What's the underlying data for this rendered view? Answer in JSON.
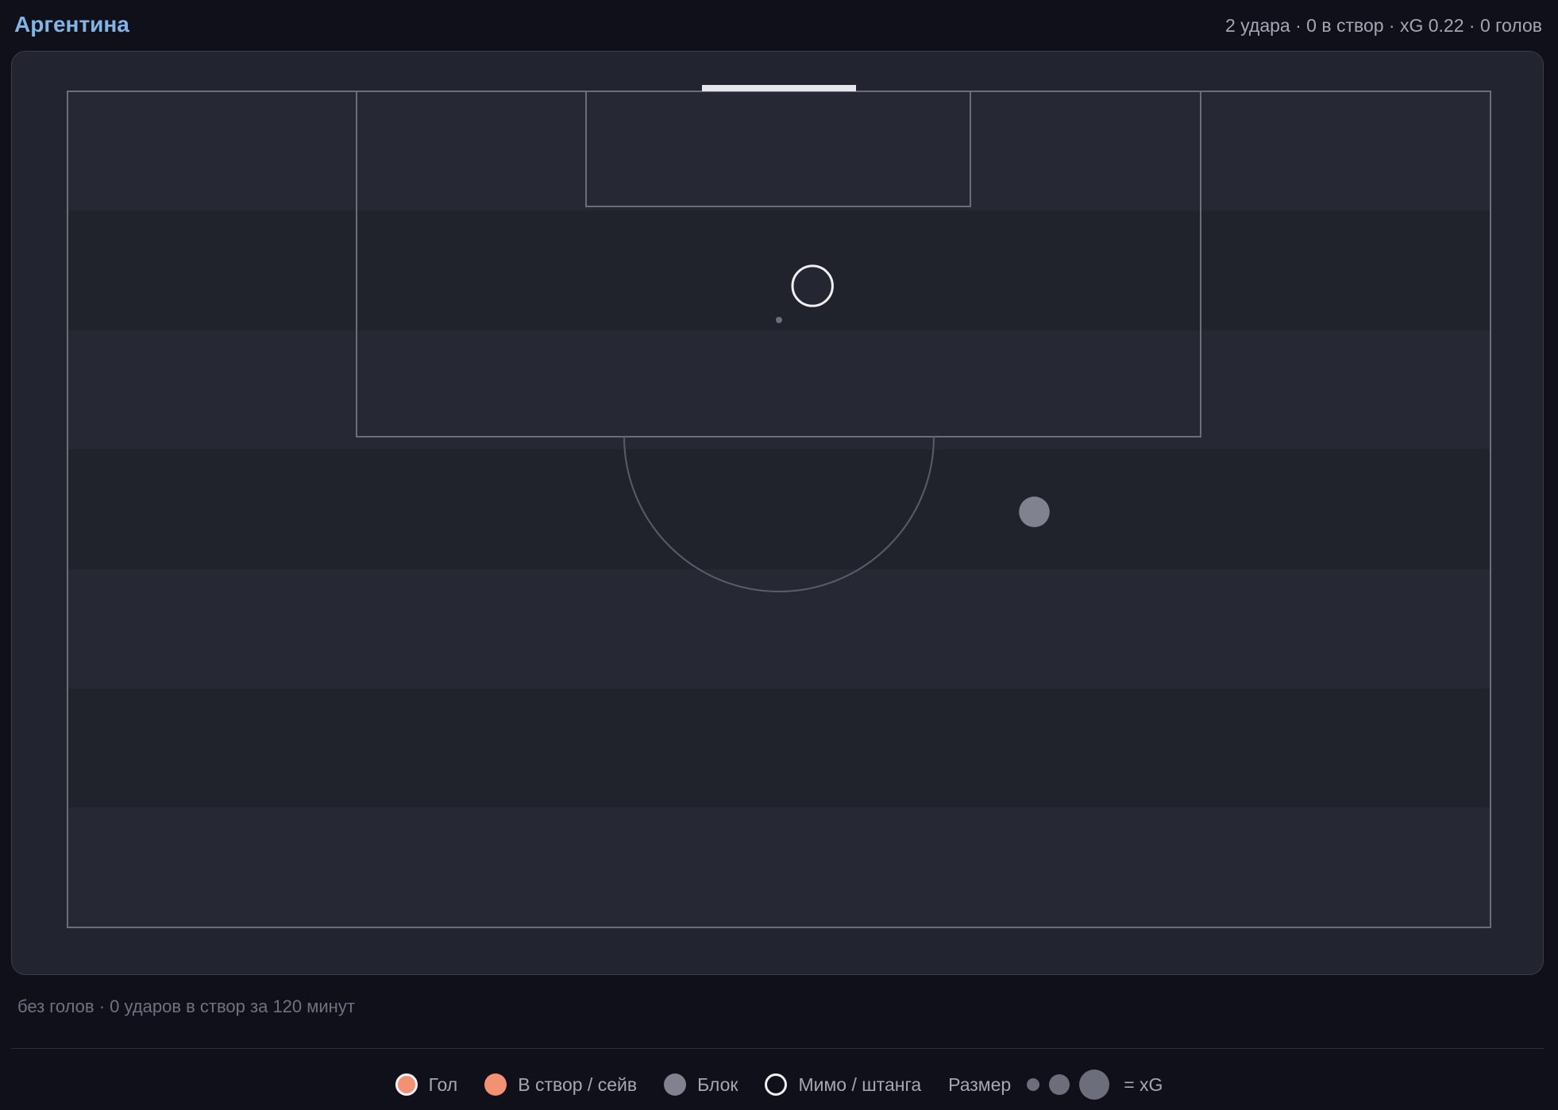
{
  "header": {
    "team": "Аргентина",
    "stats": "2 удара · 0 в створ · xG 0.22 · 0 голов"
  },
  "caption": "без голов · 0 ударов в створ за 120 минут",
  "legend": {
    "goal": "Гол",
    "on_target": "В створ / сейв",
    "blocked": "Блок",
    "off_target": "Мимо / штанга",
    "size_label": "Размер",
    "size_suffix": "= xG"
  },
  "colors": {
    "team_accent": "#7eb6e6",
    "goal": "#f39173",
    "on_target": "#f39173",
    "blocked": "#80828f",
    "off_target": "#f0f0f4"
  },
  "chart_data": {
    "type": "scatter",
    "description_units": "pitch metres from goal line; x = lateral offset from centre (+ right), y = distance from goal line",
    "pitch": {
      "width_m": 68,
      "length_m": 40
    },
    "shots": [
      {
        "outcome": "off_target",
        "x_m": 1.6,
        "y_m": 9.3,
        "xg": 0.16
      },
      {
        "outcome": "blocked",
        "x_m": 12.2,
        "y_m": 20.1,
        "xg": 0.06
      }
    ]
  }
}
